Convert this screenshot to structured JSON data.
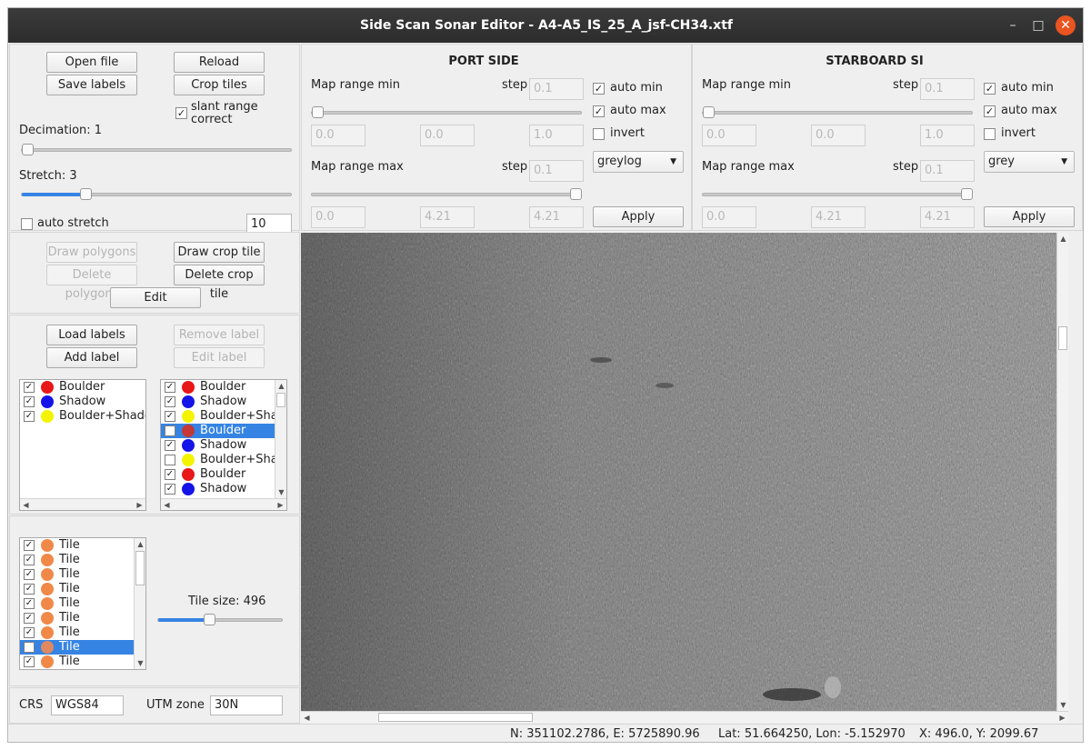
{
  "window": {
    "title": "Side Scan Sonar Editor - A4-A5_IS_25_A_jsf-CH34.xtf"
  },
  "file_panel": {
    "open_file": "Open file",
    "reload": "Reload",
    "save_labels": "Save labels",
    "crop_tiles": "Crop tiles",
    "slant_range_correct": "slant range correct",
    "decimation_label": "Decimation: 1",
    "stretch_label": "Stretch: 3",
    "auto_stretch": "auto stretch",
    "auto_stretch_value": "10"
  },
  "port_side": {
    "heading": "PORT SIDE",
    "map_range_min": "Map range min",
    "step_label": "step",
    "step_min": "0.1",
    "auto_min": "auto min",
    "auto_max": "auto max",
    "invert": "invert",
    "min_fields": [
      "0.0",
      "0.0",
      "1.0"
    ],
    "map_range_max": "Map range max",
    "step_max": "0.1",
    "colormap": "greylog",
    "max_fields": [
      "0.0",
      "4.21",
      "4.21"
    ],
    "apply": "Apply"
  },
  "starboard_side": {
    "heading": "STARBOARD SI",
    "map_range_min": "Map range min",
    "step_label": "step",
    "step_min": "0.1",
    "auto_min": "auto min",
    "auto_max": "auto max",
    "invert": "invert",
    "min_fields": [
      "0.0",
      "0.0",
      "1.0"
    ],
    "map_range_max": "Map range max",
    "step_max": "0.1",
    "colormap": "grey",
    "max_fields": [
      "0.0",
      "4.21",
      "4.21"
    ],
    "apply": "Apply"
  },
  "draw_panel": {
    "draw_polygons": "Draw polygons",
    "draw_crop_tile": "Draw crop tile",
    "delete_polygons": "Delete polygons",
    "delete_crop_tile": "Delete crop tile",
    "edit": "Edit"
  },
  "labels_panel": {
    "load_labels": "Load labels",
    "remove_label": "Remove label",
    "add_label": "Add label",
    "edit_label": "Edit label",
    "class_list": [
      {
        "label": "Boulder",
        "checked": true,
        "color": "#e81818"
      },
      {
        "label": "Shadow",
        "checked": true,
        "color": "#1414e8"
      },
      {
        "label": "Boulder+Shadow",
        "checked": true,
        "color": "#f4f400"
      }
    ],
    "polygon_list": [
      {
        "label": "Boulder",
        "checked": true,
        "color": "#e81818",
        "selected": false
      },
      {
        "label": "Shadow",
        "checked": true,
        "color": "#1414e8",
        "selected": false
      },
      {
        "label": "Boulder+Shadow",
        "checked": true,
        "color": "#f4f400",
        "selected": false
      },
      {
        "label": "Boulder",
        "checked": false,
        "color": "#c43838",
        "selected": true
      },
      {
        "label": "Shadow",
        "checked": true,
        "color": "#1414e8",
        "selected": false
      },
      {
        "label": "Boulder+Shadow",
        "checked": false,
        "color": "#f4f400",
        "selected": false
      },
      {
        "label": "Boulder",
        "checked": true,
        "color": "#e81818",
        "selected": false
      },
      {
        "label": "Shadow",
        "checked": true,
        "color": "#1414e8",
        "selected": false
      }
    ]
  },
  "tiles_panel": {
    "tile_list": [
      {
        "label": "Tile",
        "checked": true,
        "color": "#f08848",
        "selected": false
      },
      {
        "label": "Tile",
        "checked": true,
        "color": "#f08848",
        "selected": false
      },
      {
        "label": "Tile",
        "checked": true,
        "color": "#f08848",
        "selected": false
      },
      {
        "label": "Tile",
        "checked": true,
        "color": "#f08848",
        "selected": false
      },
      {
        "label": "Tile",
        "checked": true,
        "color": "#f08848",
        "selected": false
      },
      {
        "label": "Tile",
        "checked": true,
        "color": "#f08848",
        "selected": false
      },
      {
        "label": "Tile",
        "checked": true,
        "color": "#f08848",
        "selected": false
      },
      {
        "label": "Tile",
        "checked": false,
        "color": "#e08860",
        "selected": true
      },
      {
        "label": "Tile",
        "checked": true,
        "color": "#f08848",
        "selected": false
      }
    ],
    "tile_size_label": "Tile size: 496"
  },
  "crs_panel": {
    "crs_label": "CRS",
    "crs_value": "WGS84",
    "utm_label": "UTM zone",
    "utm_value": "30N"
  },
  "status": {
    "northing_easting": "N:  351102.2786, E:  5725890.96",
    "lat_lon": "Lat:  51.664250, Lon: -5.152970",
    "xy": "X: 496.0, Y: 2099.67"
  },
  "colors": {
    "accent": "#3584e4",
    "close": "#e95420",
    "titlebar": "#2c2c2c"
  }
}
